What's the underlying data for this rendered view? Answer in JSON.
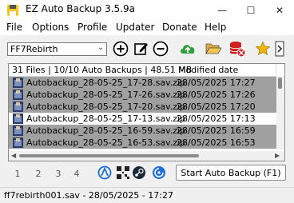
{
  "window": {
    "title": "EZ Auto Backup 3.5.9a",
    "minimize_glyph": "—",
    "maximize_glyph": "☐",
    "close_glyph": "✕"
  },
  "menu": [
    "File",
    "Options",
    "Profile",
    "Updater",
    "Donate",
    "Help"
  ],
  "toolbar": {
    "profile_value": "FF7Rebirth",
    "icons": [
      "add-profile-icon",
      "edit-profile-icon",
      "remove-profile-icon",
      "cloud-upload-icon",
      "open-folder-icon",
      "database-delete-icon",
      "favorite-star-icon",
      "collapse-panel-icon"
    ]
  },
  "list": {
    "header_summary": "31 Files | 10/10 Auto Backups | 48.51 MB",
    "header_date": "Modified date",
    "rows": [
      {
        "name": "Autobackup_28-05-25_17-28.sav.zip",
        "date": "28/05/2025 17:27",
        "selected": true
      },
      {
        "name": "Autobackup_28-05-25_17-26.sav.zip",
        "date": "28/05/2025 17:26",
        "selected": true
      },
      {
        "name": "Autobackup_28-05-25_17-20.sav.zip",
        "date": "28/05/2025 17:20",
        "selected": true
      },
      {
        "name": "Autobackup_28-05-25_17-13.sav.zip",
        "date": "28/05/2025 17:13",
        "selected": false
      },
      {
        "name": "Autobackup_28-05-25_16-59.sav.zip",
        "date": "28/05/2025 16:59",
        "selected": true
      },
      {
        "name": "Autobackup_28-05-25_16-53.sav.zip",
        "date": "28/05/2025 16:53",
        "selected": true
      }
    ]
  },
  "pages": [
    "1",
    "2",
    "3",
    "4"
  ],
  "bottom_icons": [
    "steam-deck-icon",
    "qr-code-icon",
    "steam-icon",
    "ubisoft-icon"
  ],
  "start_button": "Start Auto Backup (F1)",
  "status": "ff7rebirth001.sav - 28/05/2025 - 17:27",
  "colors": {
    "selected_row": "#a0a0a0",
    "accent_blue": "#1e6fd9",
    "cloud_green": "#2e9e3e",
    "folder_orange": "#d99a2b",
    "database_red": "#cc2222",
    "star_gold": "#f0b400"
  }
}
